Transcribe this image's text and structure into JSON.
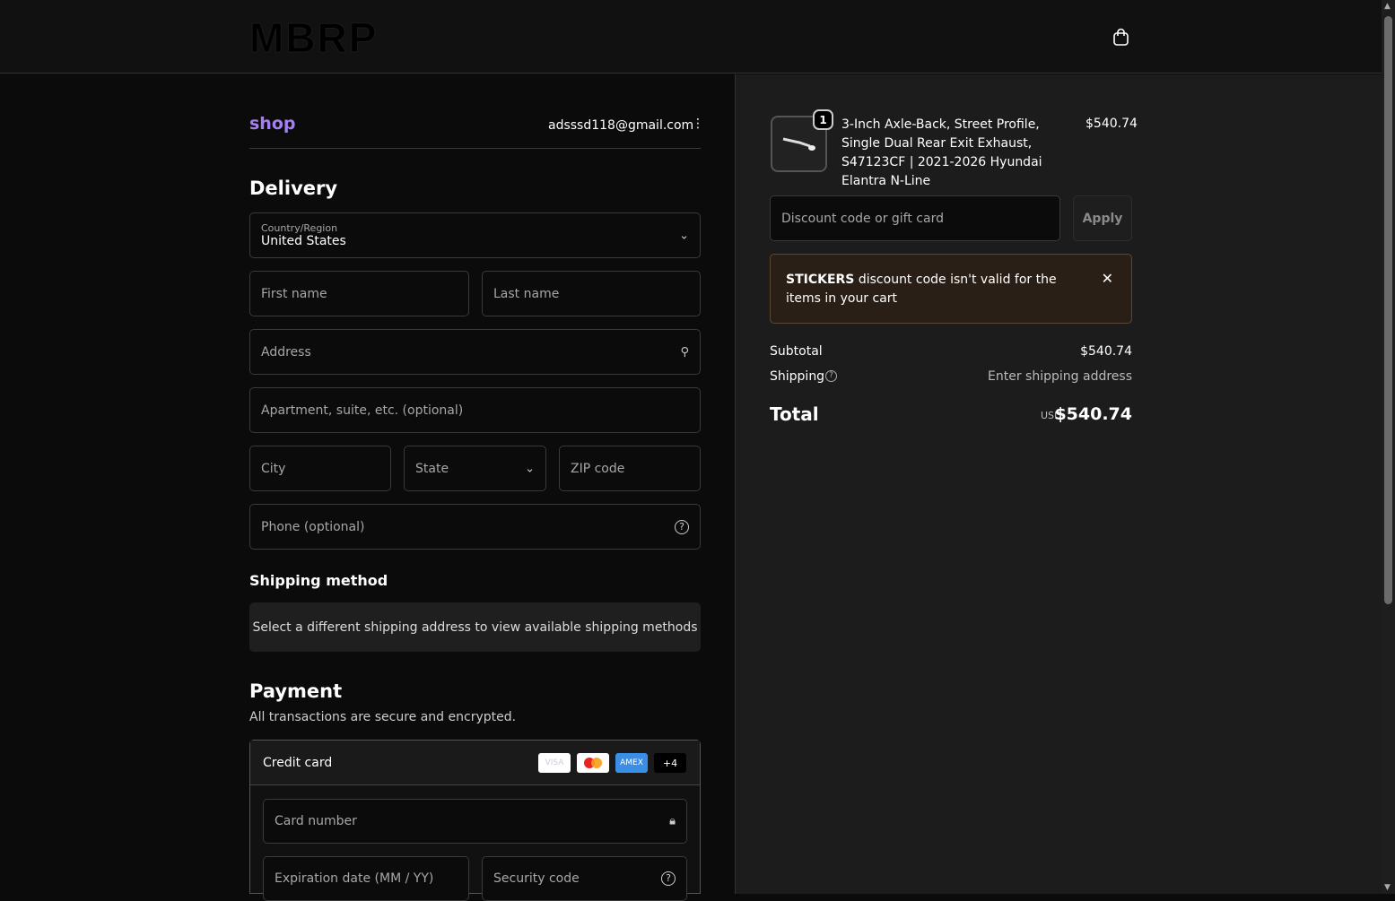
{
  "header": {
    "logo": "MBRP"
  },
  "account": {
    "brand": "shop",
    "email": "adsssd118@gmail.com"
  },
  "delivery": {
    "title": "Delivery",
    "country_label": "Country/Region",
    "country_value": "United States",
    "first_name": "First name",
    "last_name": "Last name",
    "address": "Address",
    "apartment": "Apartment, suite, etc. (optional)",
    "city": "City",
    "state": "State",
    "zip": "ZIP code",
    "phone": "Phone (optional)"
  },
  "shipping_method": {
    "title": "Shipping method",
    "note": "Select a different shipping address to view available shipping methods"
  },
  "payment": {
    "title": "Payment",
    "subtitle": "All transactions are secure and encrypted.",
    "method": "Credit card",
    "cards": [
      "VISA",
      "AMEX",
      "+4"
    ],
    "card_number": "Card number",
    "expiration": "Expiration date (MM / YY)",
    "security": "Security code"
  },
  "cart": {
    "qty": "1",
    "item_name": "3-Inch Axle-Back, Street Profile, Single Dual Rear Exit Exhaust, S47123CF | 2021-2026 Hyundai Elantra N-Line",
    "item_price": "$540.74",
    "discount_placeholder": "Discount code or gift card",
    "apply": "Apply",
    "error_code": "STICKERS",
    "error_text": " discount code isn't valid for the items in your cart",
    "subtotal_label": "Subtotal",
    "subtotal": "$540.74",
    "shipping_label": "Shipping",
    "shipping_value": "Enter shipping address",
    "total_label": "Total",
    "currency": "USD",
    "total": "$540.74"
  }
}
